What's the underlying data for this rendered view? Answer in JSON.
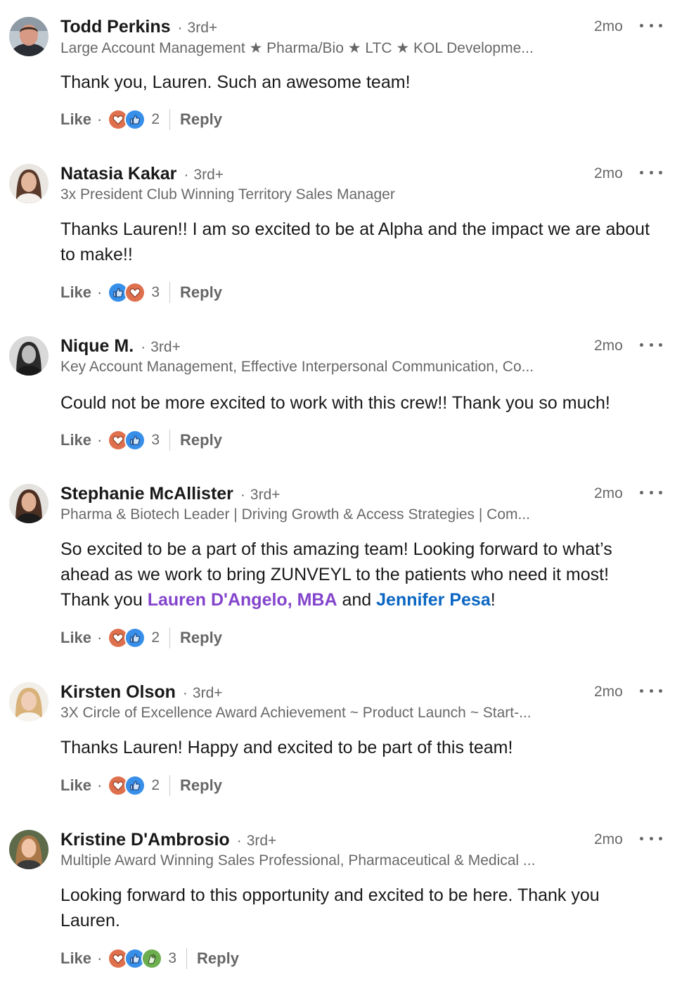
{
  "ui": {
    "like_label": "Like",
    "reply_label": "Reply",
    "separator": "·"
  },
  "colors": {
    "love": "#df704d",
    "like": "#378fe9",
    "celebrate": "#6dae4f",
    "mention_purple": "#8344cc",
    "mention_blue": "#0a66c2"
  },
  "comments": [
    {
      "name": "Todd Perkins",
      "degree": "3rd+",
      "headline": "Large Account Management ★ Pharma/Bio ★ LTC ★ KOL Developme...",
      "time": "2mo",
      "text": "Thank you, Lauren. Such an awesome team!",
      "reactions": [
        "love-icon",
        "like-icon"
      ],
      "reaction_count": "2"
    },
    {
      "name": "Natasia Kakar",
      "degree": "3rd+",
      "headline": "3x President Club Winning Territory Sales Manager",
      "time": "2mo",
      "text": "Thanks Lauren!! I am so excited to be at Alpha and the impact we are about to make!!",
      "reactions": [
        "like-icon",
        "love-icon"
      ],
      "reaction_count": "3"
    },
    {
      "name": "Nique M.",
      "degree": "3rd+",
      "headline": "Key Account Management, Effective Interpersonal Communication, Co...",
      "time": "2mo",
      "text": "Could not be more excited to work with this crew!! Thank you so much!",
      "reactions": [
        "love-icon",
        "like-icon"
      ],
      "reaction_count": "3"
    },
    {
      "name": "Stephanie McAllister",
      "degree": "3rd+",
      "headline": "Pharma & Biotech Leader | Driving Growth & Access Strategies | Com...",
      "time": "2mo",
      "text_pre": "So excited to be a part of this amazing team! Looking forward to what’s ahead as we work to bring ZUNVEYL to the patients who need it most! Thank you ",
      "mention_1": "Lauren D'Angelo, MBA",
      "text_mid": " and ",
      "mention_2": "Jennifer Pesa",
      "text_post": "!",
      "reactions": [
        "love-icon",
        "like-icon"
      ],
      "reaction_count": "2"
    },
    {
      "name": "Kirsten Olson",
      "degree": "3rd+",
      "headline": "3X Circle of Excellence Award Achievement ~ Product Launch ~ Start-...",
      "time": "2mo",
      "text": "Thanks Lauren! Happy and excited to be part of this team!",
      "reactions": [
        "love-icon",
        "like-icon"
      ],
      "reaction_count": "2"
    },
    {
      "name": "Kristine D'Ambrosio",
      "degree": "3rd+",
      "headline": "Multiple Award Winning Sales Professional, Pharmaceutical & Medical ...",
      "time": "2mo",
      "text": "Looking forward to this opportunity and excited to be here. Thank you Lauren.",
      "reactions": [
        "love-icon",
        "like-icon",
        "celebrate-icon"
      ],
      "reaction_count": "3"
    }
  ]
}
